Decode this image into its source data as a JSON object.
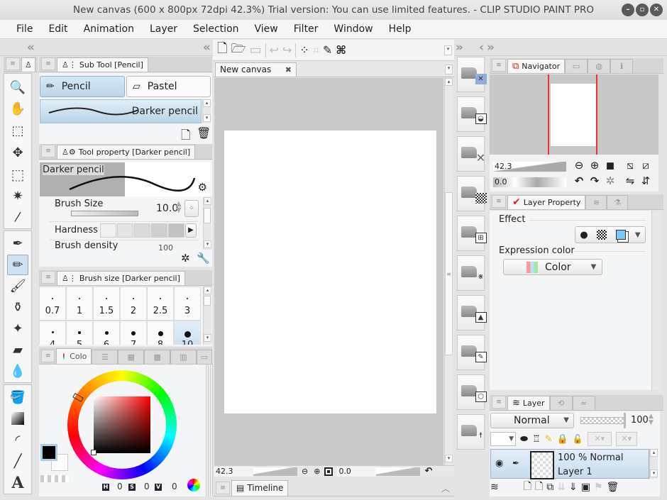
{
  "window": {
    "title": "New canvas (600 x 800px 72dpi 42.3%)  Trial version: You can use limited features. - CLIP STUDIO PAINT PRO",
    "controls": [
      "minimize-icon",
      "restore-icon",
      "close-icon"
    ]
  },
  "menu": [
    "File",
    "Edit",
    "Animation",
    "Layer",
    "Selection",
    "View",
    "Filter",
    "Window",
    "Help"
  ],
  "toolbar": {
    "icons": [
      "new-canvas-icon",
      "open-icon",
      "save-icon",
      "undo-icon",
      "redo-icon",
      "selection-dots-icon",
      "transform-icon",
      "fill-selection-icon",
      "free-transform-icon"
    ]
  },
  "tools": {
    "group1": [
      "zoom-tool",
      "hand-tool",
      "object-tool",
      "move-layer-tool",
      "selection-tool",
      "auto-select-tool",
      "eyedropper-tool"
    ],
    "group2": [
      "pen-tool",
      "pencil-tool",
      "brush-tool",
      "airbrush-tool",
      "decoration-tool",
      "eraser-tool",
      "blend-tool"
    ],
    "group3": [
      "fill-tool",
      "gradient-tool",
      "figure-tool",
      "line-tool",
      "text-tool"
    ],
    "active": "pencil-tool"
  },
  "subtool": {
    "tab_label": "Sub Tool [Pencil]",
    "groups": [
      "Pencil",
      "Pastel"
    ],
    "active_group": "Pencil",
    "selected_item": "Darker pencil"
  },
  "tool_property": {
    "tab_label": "Tool property [Darker pencil]",
    "preview_name": "Darker pencil",
    "brush_size_label": "Brush Size",
    "brush_size_value": "10.0",
    "hardness_label": "Hardness",
    "brush_density_label": "Brush density",
    "brush_density_value": "100"
  },
  "brush_size": {
    "tab_label": "Brush size [Darker pencil]",
    "row1": [
      "0.7",
      "1",
      "1.5",
      "2",
      "2.5",
      "3"
    ],
    "row2": [
      "4",
      "5",
      "6",
      "7",
      "8",
      "10"
    ],
    "selected": "10"
  },
  "color": {
    "tab_label": "Colo",
    "h_label": "H",
    "h_value": "0",
    "s_label": "S",
    "s_value": "0",
    "v_label": "V",
    "v_value": "0",
    "main_color": "#000000",
    "sub_color": "#ffffff"
  },
  "canvas": {
    "tab_label": "New canvas",
    "zoom_value": "42.3",
    "rotation_value": "0.0",
    "timeline_label": "Timeline"
  },
  "navigator": {
    "tab_label": "Navigator",
    "zoom_value": "42.3",
    "rotation_value": "0.0"
  },
  "layer_property": {
    "tab_label": "Layer Property",
    "effect_label": "Effect",
    "expression_color_label": "Expression color",
    "expression_color_value": "Color"
  },
  "layer": {
    "tab_label": "Layer",
    "blend_mode": "Normal",
    "opacity": "100",
    "layers": [
      {
        "info": "100 %  Normal",
        "name": "Layer 1"
      }
    ]
  }
}
